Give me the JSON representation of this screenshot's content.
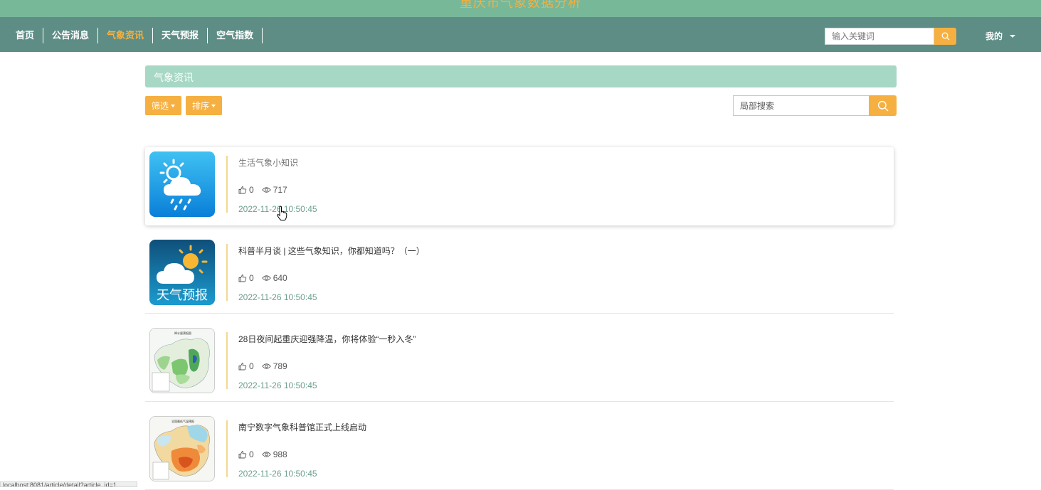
{
  "banner": {
    "title": "重庆市气象数据分析"
  },
  "nav": {
    "items": [
      {
        "label": "首页",
        "active": false
      },
      {
        "label": "公告消息",
        "active": false
      },
      {
        "label": "气象资讯",
        "active": true
      },
      {
        "label": "天气预报",
        "active": false
      },
      {
        "label": "空气指数",
        "active": false
      }
    ],
    "search_placeholder": "输入关键词",
    "user_label": "我的"
  },
  "section": {
    "title": "气象资讯",
    "filter_label": "筛选",
    "sort_label": "排序",
    "search_placeholder": "局部搜索"
  },
  "articles": [
    {
      "title": "生活气象小知识",
      "likes": "0",
      "views": "717",
      "date": "2022-11-26 10:50:45",
      "thumb": "rain-cloud-icon"
    },
    {
      "title": "科普半月谈 | 这些气象知识，你都知道吗？（一）",
      "likes": "0",
      "views": "640",
      "date": "2022-11-26 10:50:45",
      "thumb": "weather-forecast-app-icon",
      "thumb_text": "天气预报"
    },
    {
      "title": "28日夜间起重庆迎强降温，你将体验“一秒入冬”",
      "likes": "0",
      "views": "789",
      "date": "2022-11-26 10:50:45",
      "thumb": "precipitation-map-thumbnail"
    },
    {
      "title": "南宁数字气象科普馆正式上线启动",
      "likes": "0",
      "views": "988",
      "date": "2022-11-26 10:50:45",
      "thumb": "temperature-map-thumbnail"
    }
  ],
  "status_bar": {
    "url": "localhost:8081/article/detail?article_id=1"
  },
  "colors": {
    "banner": "#77b899",
    "navbar": "#5e8d86",
    "accent": "#f5b041",
    "section_header": "#a7d7c5",
    "date": "#6a9f8b"
  }
}
